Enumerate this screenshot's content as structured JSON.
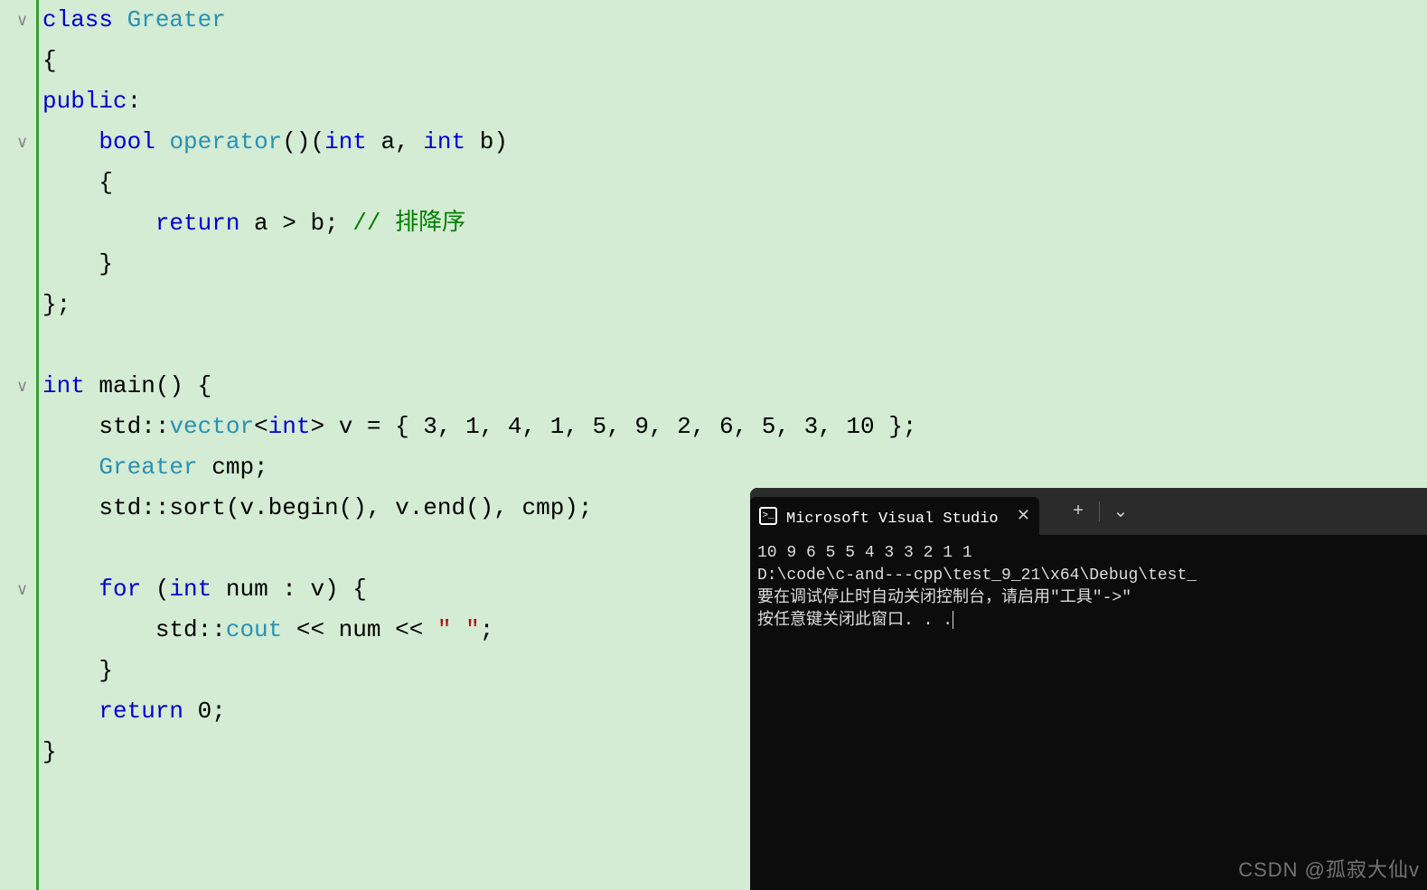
{
  "code": {
    "line1_class": "class",
    "line1_name": "Greater",
    "line2": "{",
    "line3_public": "public",
    "line3_colon": ":",
    "line4_bool": "bool",
    "line4_operator": "operator",
    "line4_params": "()(",
    "line4_int1": "int",
    "line4_a": " a, ",
    "line4_int2": "int",
    "line4_b": " b)",
    "line5": "    {",
    "line6_return": "return",
    "line6_expr": " a > b; ",
    "line6_comment": "// 排降序",
    "line7": "    }",
    "line8": "};",
    "line10_int": "int",
    "line10_main": " main() {",
    "line11_std": "std::",
    "line11_vector": "vector",
    "line11_lt": "<",
    "line11_int": "int",
    "line11_gt": "> v = { 3, 1, 4, 1, 5, 9, 2, 6, 5, 3, 10 };",
    "line12_greater": "Greater",
    "line12_cmp": " cmp;",
    "line13": "    std::sort(v.begin(), v.end(), cmp);",
    "line15_for": "for",
    "line15_paren": " (",
    "line15_int": "int",
    "line15_rest": " num : v) {",
    "line16_std": "std::",
    "line16_cout": "cout",
    "line16_op1": " << num << ",
    "line16_str": "\" \"",
    "line16_semi": ";",
    "line17": "    }",
    "line18_return": "return",
    "line18_zero": " 0;",
    "line19": "}"
  },
  "terminal": {
    "tab_title": "Microsoft Visual Studio 调试控",
    "output_line1": "10 9 6 5 5 4 3 3 2 1 1",
    "output_line2": "D:\\code\\c-and---cpp\\test_9_21\\x64\\Debug\\test_",
    "output_line3": "要在调试停止时自动关闭控制台，请启用\"工具\"->\"",
    "output_line4": "按任意键关闭此窗口. . ."
  },
  "watermark": "CSDN @孤寂大仙v"
}
